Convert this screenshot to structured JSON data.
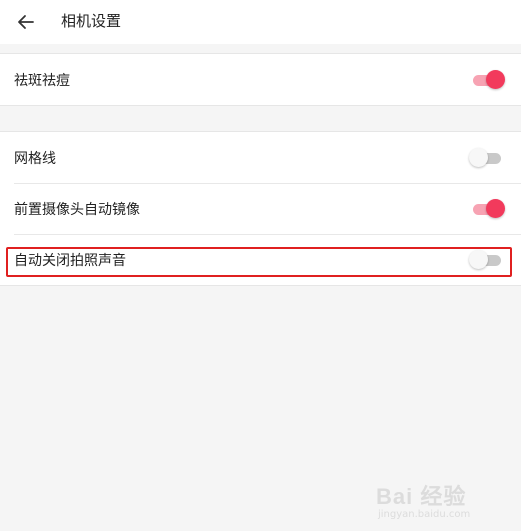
{
  "header": {
    "back_icon": "arrow-left-icon",
    "title": "相机设置"
  },
  "group1": {
    "items": [
      {
        "label": "祛斑祛痘",
        "enabled": true
      }
    ]
  },
  "group2": {
    "items": [
      {
        "label": "网格线",
        "enabled": false
      },
      {
        "label": "前置摄像头自动镜像",
        "enabled": true
      },
      {
        "label": "自动关闭拍照声音",
        "enabled": false
      }
    ]
  },
  "watermark": {
    "brand": "Bai 经验",
    "url": "jingyan.baidu.com"
  },
  "colors": {
    "accent": "#f23a5c",
    "accent_track": "#f7a3b3",
    "off_track": "#c9c9c9",
    "highlight": "#e02020",
    "background": "#f5f5f5"
  }
}
